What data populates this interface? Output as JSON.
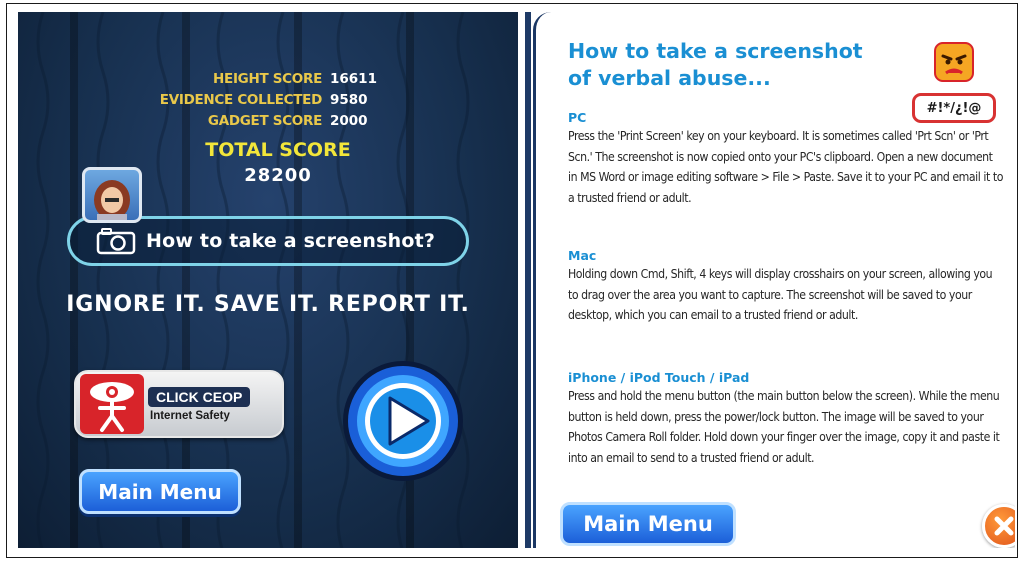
{
  "left": {
    "scores": [
      {
        "label": "HEIGHT SCORE",
        "value": "16611"
      },
      {
        "label": "EVIDENCE COLLECTED",
        "value": "9580"
      },
      {
        "label": "GADGET SCORE",
        "value": "2000"
      }
    ],
    "total_label": "TOTAL SCORE",
    "total_value": "28200",
    "screenshot_button": "How to take a screenshot?",
    "slogan": "IGNORE IT. SAVE IT. REPORT IT.",
    "ceop": {
      "top": "CLICK CEOP",
      "bottom": "Internet Safety"
    },
    "main_menu": "Main Menu"
  },
  "right": {
    "title": "How to take a screenshot of verbal abuse...",
    "curse": "#!*/¿!@",
    "sections": [
      {
        "heading": "PC",
        "body": "Press the 'Print Screen' key on your keyboard. It is sometimes called 'Prt Scn' or 'Prt Scn.' The screenshot is now copied onto your PC's clipboard. Open a new document in MS Word or image editing software > File > Paste. Save it to your PC and email it to a trusted friend or adult."
      },
      {
        "heading": "Mac",
        "body": "Holding down Cmd, Shift, 4 keys will display crosshairs on your screen, allowing you to drag over the area you want to capture. The screenshot will be saved to your desktop, which you can email to a trusted friend or adult."
      },
      {
        "heading": "iPhone / iPod Touch / iPad",
        "body": "Press and hold the menu button (the main button below the screen). While the menu button is held down, press the power/lock button. The image will be saved to your Photos Camera Roll folder. Hold down your finger over the image, copy it and paste it into an email to send to a trusted friend or adult."
      }
    ],
    "main_menu": "Main Menu"
  },
  "colors": {
    "score_label": "#e9c84a",
    "total_label": "#f2e63a",
    "title_blue": "#1a8fd3",
    "button_blue": "#1c5fd8",
    "close_orange": "#e0531a",
    "ceop_red": "#d8242a"
  },
  "icons": {
    "camera": "camera-icon",
    "play": "play-icon",
    "close": "close-icon",
    "avatar": "avatar",
    "angry_face": "angry-face-icon",
    "ceop_logo": "ceop-logo"
  }
}
